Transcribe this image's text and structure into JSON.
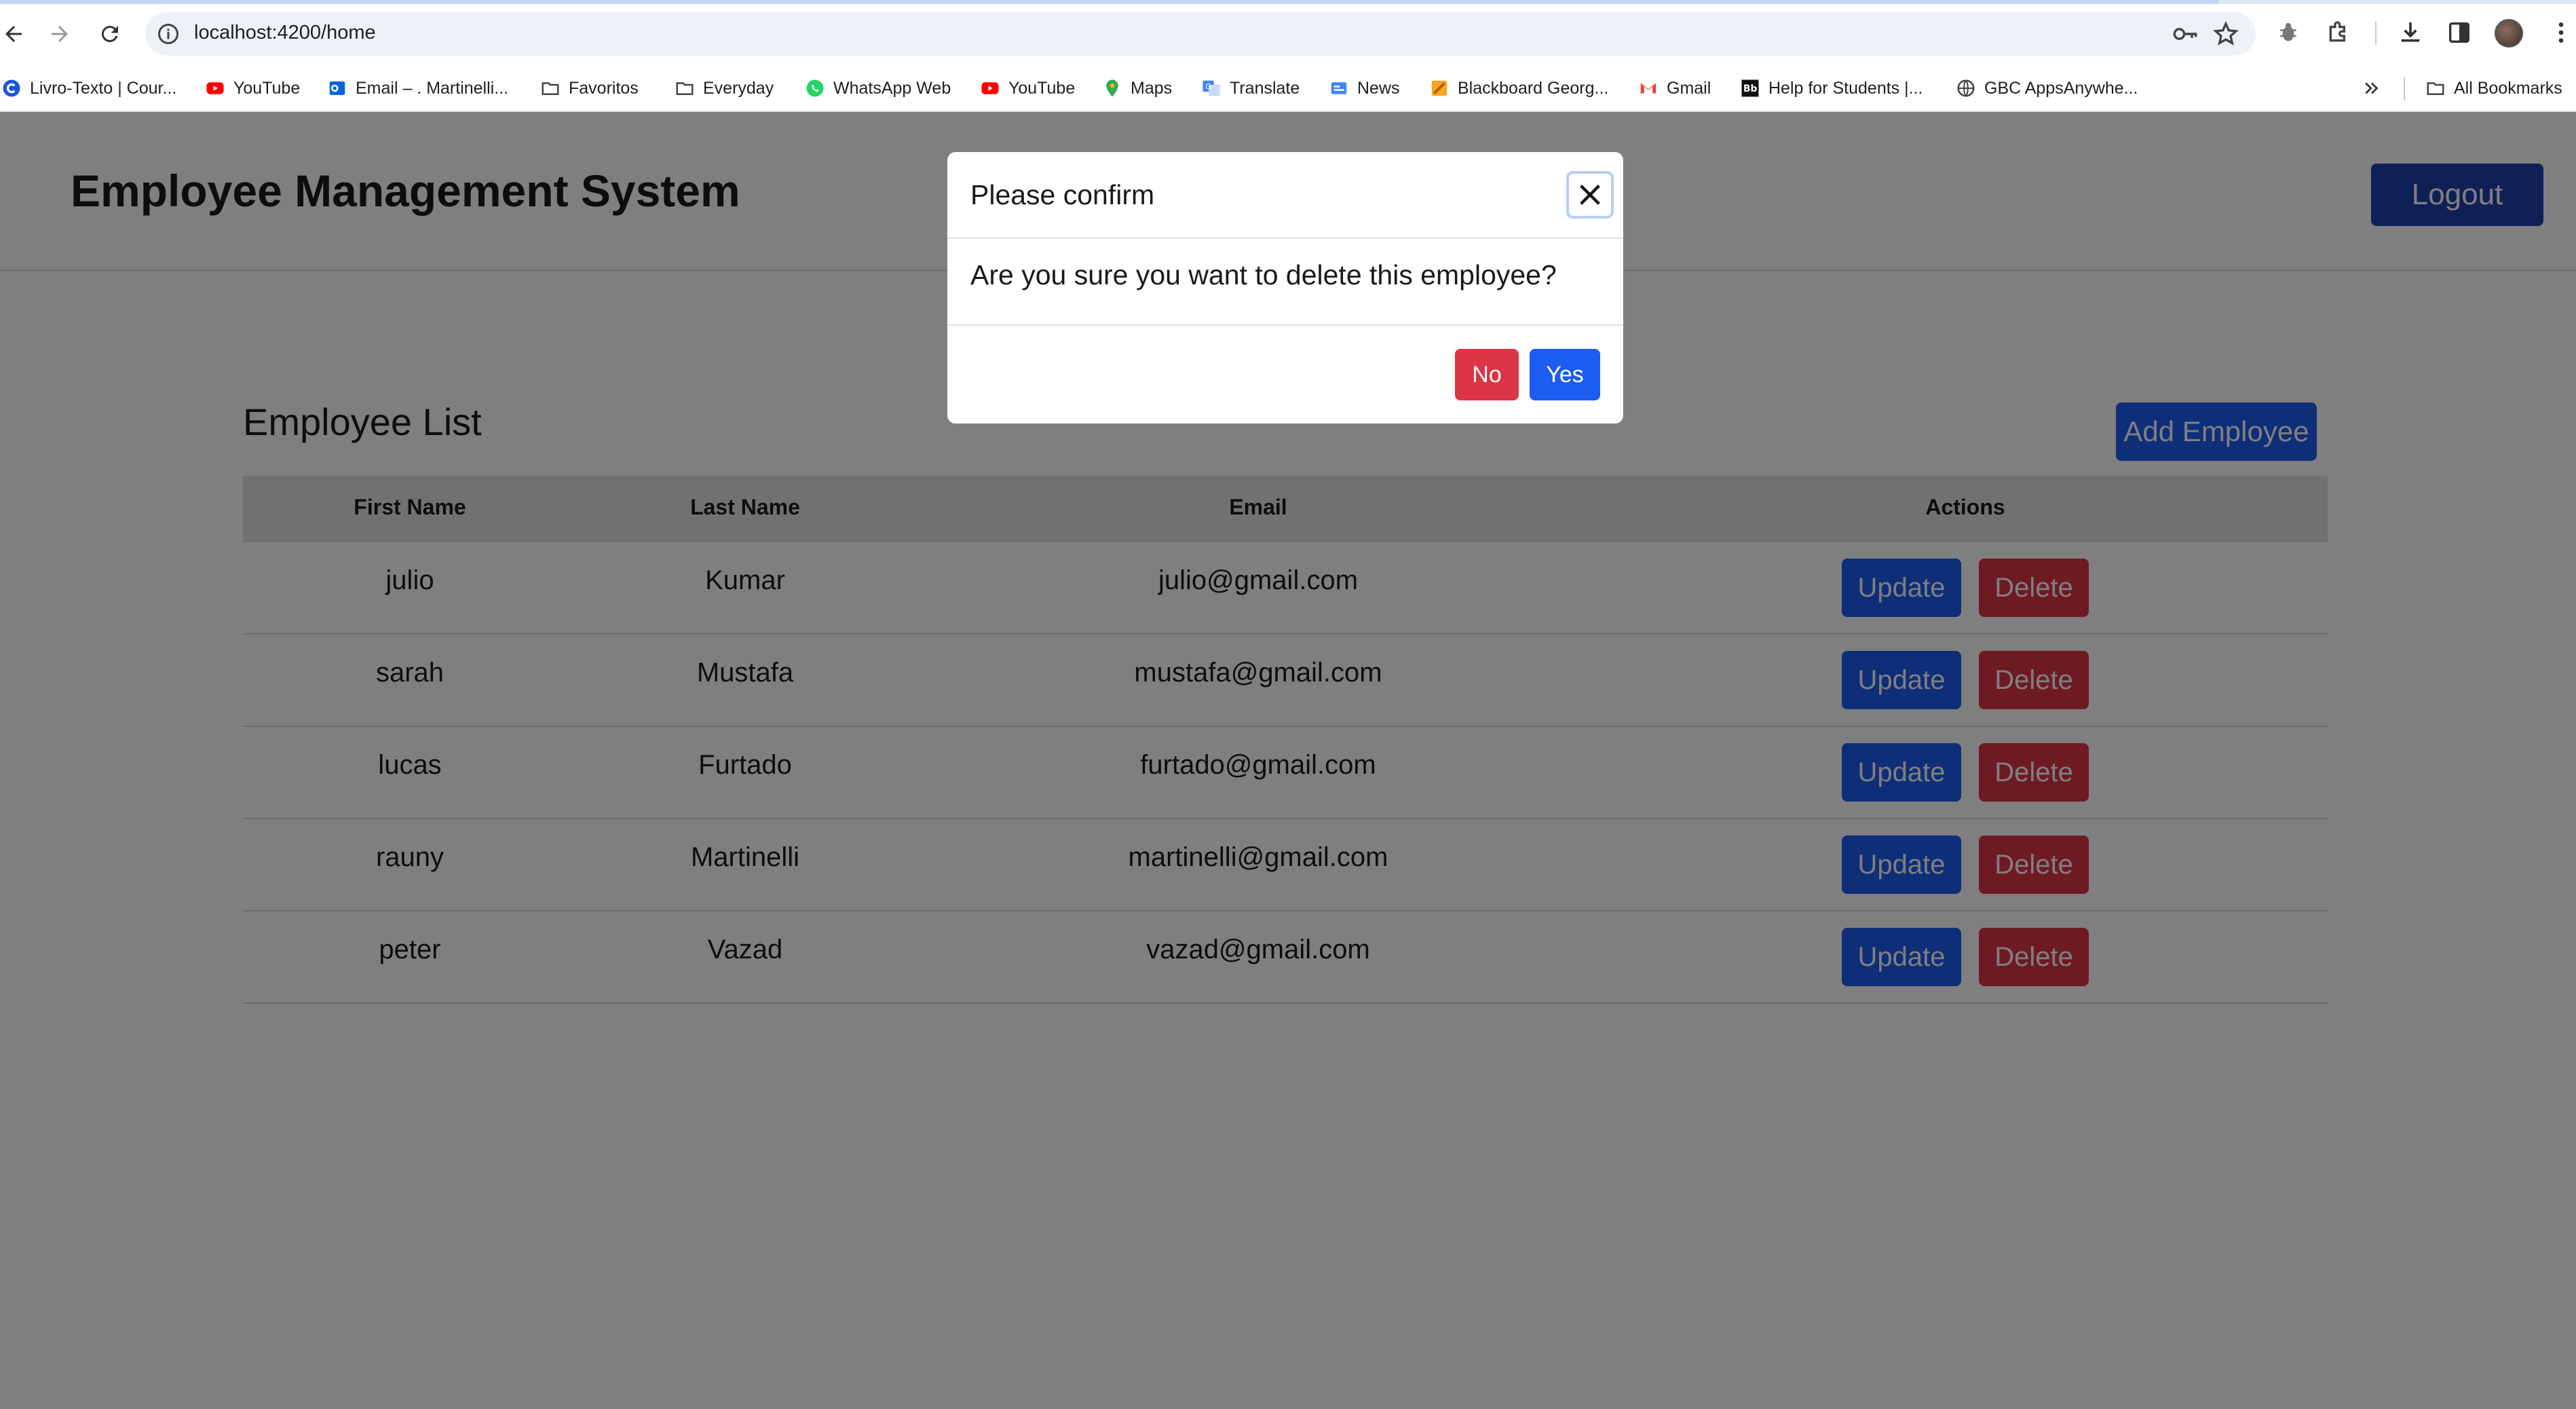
{
  "browser": {
    "url": "localhost:4200/home",
    "bookmarks": [
      {
        "label": "Livro-Texto | Cour...",
        "icon": "c-logo-icon"
      },
      {
        "label": "YouTube",
        "icon": "youtube-icon"
      },
      {
        "label": "Email – . Martinelli...",
        "icon": "outlook-icon"
      },
      {
        "label": "Favoritos",
        "icon": "folder-icon"
      },
      {
        "label": "Everyday",
        "icon": "folder-icon"
      },
      {
        "label": "WhatsApp Web",
        "icon": "whatsapp-icon"
      },
      {
        "label": "YouTube",
        "icon": "youtube-icon"
      },
      {
        "label": "Maps",
        "icon": "maps-icon"
      },
      {
        "label": "Translate",
        "icon": "translate-icon"
      },
      {
        "label": "News",
        "icon": "news-icon"
      },
      {
        "label": "Blackboard Georg...",
        "icon": "blackboard-icon"
      },
      {
        "label": "Gmail",
        "icon": "gmail-icon"
      },
      {
        "label": "Help for Students |...",
        "icon": "bb-icon"
      },
      {
        "label": "GBC AppsAnywhe...",
        "icon": "globe-icon"
      }
    ],
    "all_bookmarks": "All Bookmarks"
  },
  "app": {
    "title": "Employee Management System",
    "logout_label": "Logout",
    "list_title": "Employee List",
    "add_label": "Add Employee",
    "columns": [
      "First Name",
      "Last Name",
      "Email",
      "Actions"
    ],
    "rows": [
      {
        "first": "julio",
        "last": "Kumar",
        "email": "julio@gmail.com"
      },
      {
        "first": "sarah",
        "last": "Mustafa",
        "email": "mustafa@gmail.com"
      },
      {
        "first": "lucas",
        "last": "Furtado",
        "email": "furtado@gmail.com"
      },
      {
        "first": "rauny",
        "last": "Martinelli",
        "email": "martinelli@gmail.com"
      },
      {
        "first": "peter",
        "last": "Vazad",
        "email": "vazad@gmail.com"
      }
    ],
    "update_label": "Update",
    "delete_label": "Delete"
  },
  "modal": {
    "title": "Please confirm",
    "message": "Are you sure you want to delete this employee?",
    "no_label": "No",
    "yes_label": "Yes"
  },
  "colors": {
    "primary": "#1d5cf0",
    "danger": "#dc3545",
    "logout": "#1e40af"
  }
}
